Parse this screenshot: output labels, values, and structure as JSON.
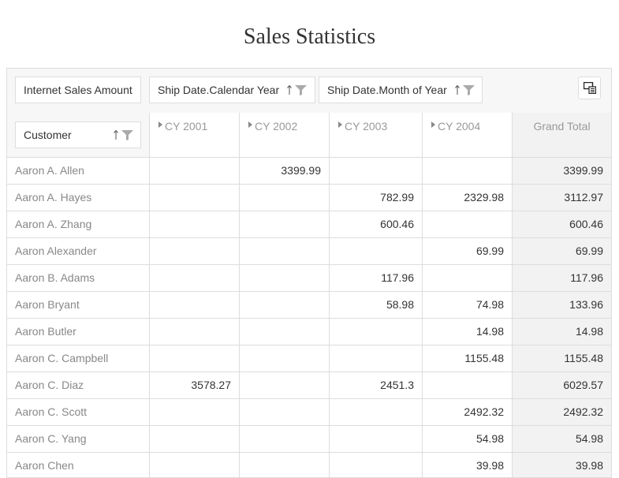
{
  "title": "Sales Statistics",
  "fields": {
    "data_field": "Internet Sales Amount",
    "column_field_1": "Ship Date.Calendar Year",
    "column_field_2": "Ship Date.Month of Year",
    "row_field": "Customer"
  },
  "columns": [
    "CY 2001",
    "CY 2002",
    "CY 2003",
    "CY 2004"
  ],
  "grand_total_label": "Grand Total",
  "rows": [
    {
      "name": "Aaron A. Allen",
      "values": [
        "",
        "3399.99",
        "",
        ""
      ],
      "total": "3399.99"
    },
    {
      "name": "Aaron A. Hayes",
      "values": [
        "",
        "",
        "782.99",
        "2329.98"
      ],
      "total": "3112.97"
    },
    {
      "name": "Aaron A. Zhang",
      "values": [
        "",
        "",
        "600.46",
        ""
      ],
      "total": "600.46"
    },
    {
      "name": "Aaron Alexander",
      "values": [
        "",
        "",
        "",
        "69.99"
      ],
      "total": "69.99"
    },
    {
      "name": "Aaron B. Adams",
      "values": [
        "",
        "",
        "117.96",
        ""
      ],
      "total": "117.96"
    },
    {
      "name": "Aaron Bryant",
      "values": [
        "",
        "",
        "58.98",
        "74.98"
      ],
      "total": "133.96"
    },
    {
      "name": "Aaron Butler",
      "values": [
        "",
        "",
        "",
        "14.98"
      ],
      "total": "14.98"
    },
    {
      "name": "Aaron C. Campbell",
      "values": [
        "",
        "",
        "",
        "1155.48"
      ],
      "total": "1155.48"
    },
    {
      "name": "Aaron C. Diaz",
      "values": [
        "3578.27",
        "",
        "2451.3",
        ""
      ],
      "total": "6029.57"
    },
    {
      "name": "Aaron C. Scott",
      "values": [
        "",
        "",
        "",
        "2492.32"
      ],
      "total": "2492.32"
    },
    {
      "name": "Aaron C. Yang",
      "values": [
        "",
        "",
        "",
        "54.98"
      ],
      "total": "54.98"
    },
    {
      "name": "Aaron Chen",
      "values": [
        "",
        "",
        "",
        "39.98"
      ],
      "total": "39.98"
    }
  ]
}
